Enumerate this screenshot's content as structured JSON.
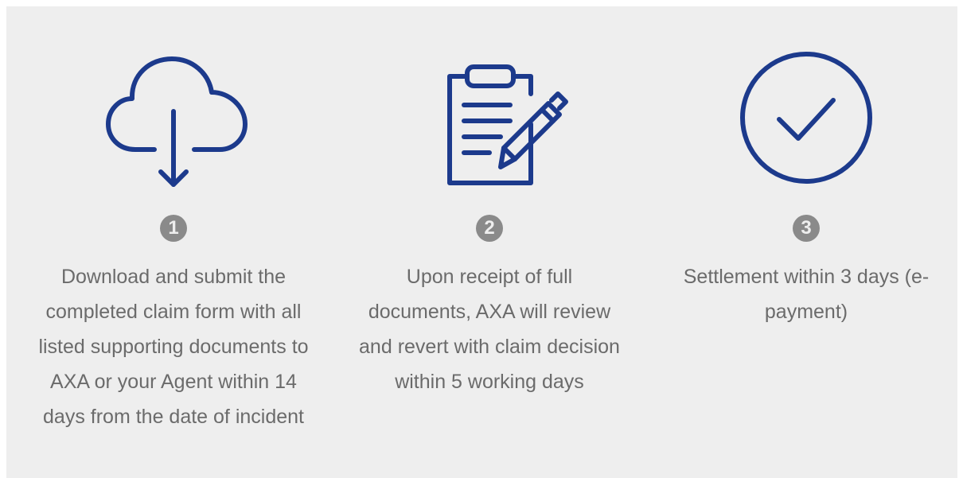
{
  "brand_color": "#1c3a8c",
  "steps": [
    {
      "number": "1",
      "icon": "cloud-download-icon",
      "description": "Download and submit the completed claim form with all listed supporting documents to AXA or your Agent within 14 days from the date of incident"
    },
    {
      "number": "2",
      "icon": "clipboard-pen-icon",
      "description": "Upon receipt of full documents, AXA will review and revert with claim decision within 5 working days"
    },
    {
      "number": "3",
      "icon": "checkmark-circle-icon",
      "description": "Settlement within 3 days (e-payment)"
    }
  ]
}
